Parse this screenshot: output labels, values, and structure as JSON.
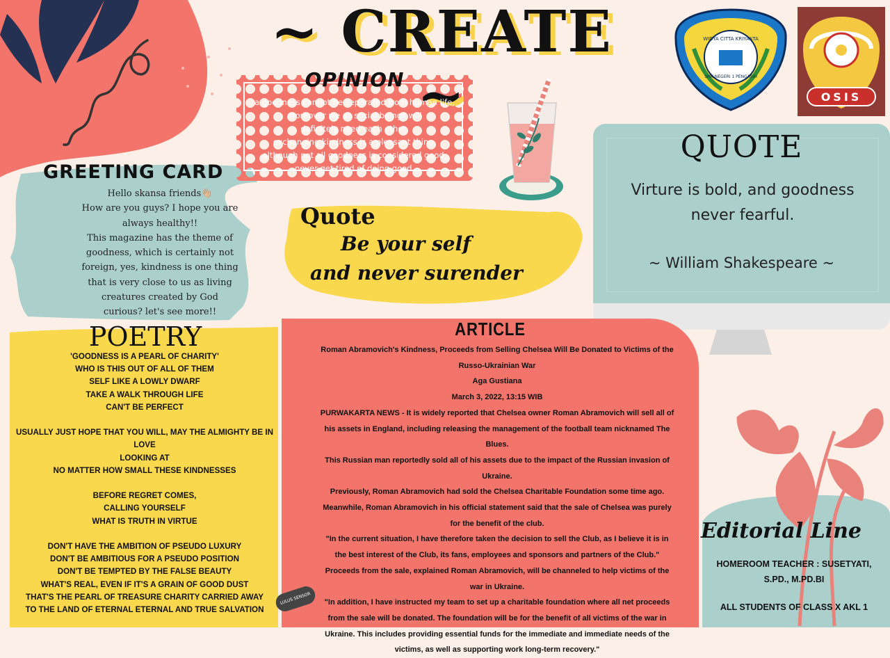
{
  "title": "~ CREATE ~",
  "opinion": {
    "title": "OPINION",
    "lines": [
      "a goodness cannot be separated from human life,",
      "moreover we as social beings will",
      "definitely need each other,",
      "exchanging kindness is a pleasant thing,",
      "although not all goodness is considered good,",
      "never get tired of doing good."
    ]
  },
  "greeting": {
    "title": "GREETING CARD",
    "lines": [
      "Hello skansa friends👋🏼",
      "How are you guys? I hope you are",
      "always healthy!!",
      "This magazine has the theme of",
      "goodness, which is certainly not",
      "foreign, yes, kindness is one thing",
      "that is very close to us as living",
      "creatures created by God",
      "curious? let's see more!!"
    ]
  },
  "poetry": {
    "title": "POETRY",
    "lines": [
      "'Goodness is a pearl of charity'",
      "who is this out of all of them",
      "self like a lowly dwarf",
      "take a walk through life",
      "can't be perfect",
      "",
      "usually just hope that you will, may the Almighty be in love",
      "looking at",
      "no matter how small these kindnesses",
      "",
      "before regret comes,",
      "calling yourself",
      "what is truth in virtue",
      "",
      "don't have the ambition of pseudo luxury",
      "don't be ambitious for a pseudo position",
      "don't be tempted by the false beauty",
      "what's real, even if it's a grain of good dust",
      "that's the pearl of treasure charity carried away",
      "to the land of eternal eternal and true salvation"
    ]
  },
  "yellow_quote": {
    "title": "Quote",
    "line1": "Be your self",
    "line2": "and never surender"
  },
  "article": {
    "title": "ARTICLE",
    "lines": [
      "Roman Abramovich's Kindness, Proceeds from Selling Chelsea Will Be Donated to Victims of the Russo-Ukrainian War",
      "Aga Gustiana",
      "March 3, 2022, 13:15 WIB",
      "PURWAKARTA NEWS - It is widely reported that Chelsea owner Roman Abramovich will sell all of his assets in England, including releasing the management of the football team nicknamed The Blues.",
      "This Russian man reportedly sold all of his assets due to the impact of the Russian invasion of Ukraine.",
      "Previously, Roman Abramovich had sold the Chelsea Charitable Foundation some time ago.",
      "Meanwhile, Roman Abramovich in his official statement said that the sale of Chelsea was purely for the benefit of the club.",
      "\"In the current situation, I have therefore taken the decision to sell the Club, as I believe it is in the best interest of the Club, its fans, employees and sponsors and partners of the Club.\"",
      "Proceeds from the sale, explained Roman Abramovich, will be channeled to help victims of the war in Ukraine.",
      "\"In addition, I have instructed my team to set up a charitable foundation where all net proceeds from the sale will be donated. The foundation will be for the benefit of all victims of the war in Ukraine. This includes providing essential funds for the immediate and immediate needs of the victims, as well as supporting work  long-term recovery.\""
    ]
  },
  "monitor_quote": {
    "title": "QUOTE",
    "text": "Virture is bold, and goodness never fearful.",
    "author": "~ William Shakespeare ~"
  },
  "editorial": {
    "title": "Editorial Line",
    "teacher": "HOMEROOM TEACHER : SUSETYATI, S.PD., M.PD.BI",
    "students": "ALL STUDENTS OF CLASS X AKL 1"
  },
  "logos": {
    "school_text_top": "WIDYA CITTA KRIYASTA",
    "school_text_bottom": "SMK NEGERI 1 PENGASIH",
    "osis_text": "OSIS"
  },
  "badge": "LULUS SENSOR",
  "colors": {
    "background": "#fcefe8",
    "coral": "#f2746a",
    "yellow": "#f7d24a",
    "teal": "#abcfcb",
    "navy": "#253152"
  }
}
